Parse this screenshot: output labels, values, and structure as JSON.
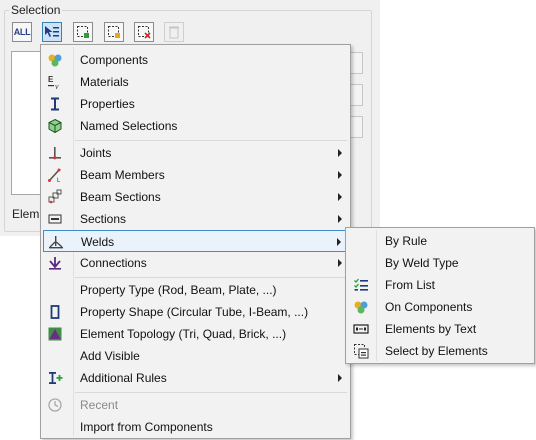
{
  "panel": {
    "group_title": "Selection",
    "elements_label": "Elem",
    "toolbar": {
      "all_label": "ALL"
    }
  },
  "menu": {
    "items": [
      {
        "label": "Components",
        "icon": "components-icon",
        "submenu": false
      },
      {
        "label": "Materials",
        "icon": "materials-icon",
        "submenu": false
      },
      {
        "label": "Properties",
        "icon": "properties-icon",
        "submenu": false
      },
      {
        "label": "Named Selections",
        "icon": "named-selections-icon",
        "submenu": false
      },
      {
        "label": "Joints",
        "icon": "joints-icon",
        "submenu": true
      },
      {
        "label": "Beam Members",
        "icon": "beam-members-icon",
        "submenu": true
      },
      {
        "label": "Beam Sections",
        "icon": "beam-sections-icon",
        "submenu": true
      },
      {
        "label": "Sections",
        "icon": "sections-icon",
        "submenu": true
      },
      {
        "label": "Welds",
        "icon": "welds-icon",
        "submenu": true,
        "highlighted": true
      },
      {
        "label": "Connections",
        "icon": "connections-icon",
        "submenu": true
      },
      {
        "label": "Property Type (Rod, Beam, Plate, ...)",
        "icon": "property-type-icon",
        "submenu": false
      },
      {
        "label": "Property Shape (Circular Tube, I-Beam, ...)",
        "icon": "property-shape-icon",
        "submenu": false
      },
      {
        "label": "Element Topology (Tri, Quad, Brick, ...)",
        "icon": "element-topology-icon",
        "submenu": false
      },
      {
        "label": "Add Visible",
        "icon": "",
        "submenu": false
      },
      {
        "label": "Additional Rules",
        "icon": "additional-rules-icon",
        "submenu": true
      },
      {
        "label": "Recent",
        "icon": "recent-icon",
        "submenu": false,
        "disabled": true
      },
      {
        "label": "Import from Components",
        "icon": "",
        "submenu": false
      }
    ]
  },
  "submenu": {
    "items": [
      {
        "label": "By Rule",
        "icon": ""
      },
      {
        "label": "By Weld Type",
        "icon": ""
      },
      {
        "label": "From List",
        "icon": "list-icon"
      },
      {
        "label": "On Components",
        "icon": "components-icon"
      },
      {
        "label": "Elements by Text",
        "icon": "text-id-icon"
      },
      {
        "label": "Select by Elements",
        "icon": "select-elements-icon"
      }
    ]
  },
  "colors": {
    "highlight_border": "#3d8ed1",
    "highlight_fill": "#eaf3fb",
    "menu_bg": "#f2f2f2",
    "panel_bg": "#f0f0f0"
  }
}
